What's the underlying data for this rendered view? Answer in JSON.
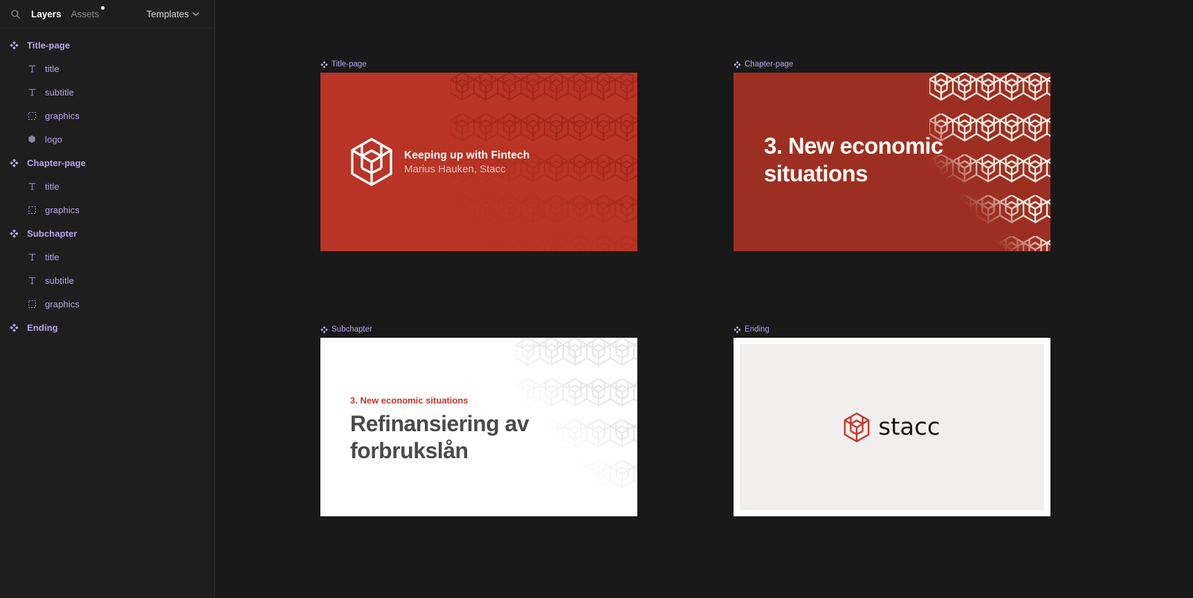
{
  "sidebar": {
    "search_icon": "search-icon",
    "tabs": [
      {
        "label": "Layers",
        "active": true,
        "badge": false
      },
      {
        "label": "Assets",
        "active": false,
        "badge": true
      }
    ],
    "templates_dropdown": {
      "label": "Templates",
      "chevron_icon": "chevron-down-icon"
    },
    "layers": [
      {
        "label": "Title-page",
        "icon": "component-icon",
        "level": 0
      },
      {
        "label": "title",
        "icon": "text-icon",
        "level": 1
      },
      {
        "label": "subtitle",
        "icon": "text-icon",
        "level": 1
      },
      {
        "label": "graphics",
        "icon": "frame-icon",
        "level": 1
      },
      {
        "label": "logo",
        "icon": "polygon-icon",
        "level": 1
      },
      {
        "label": "Chapter-page",
        "icon": "component-icon",
        "level": 0
      },
      {
        "label": "title",
        "icon": "text-icon",
        "level": 1
      },
      {
        "label": "graphics",
        "icon": "frame-icon",
        "level": 1
      },
      {
        "label": "Subchapter",
        "icon": "component-icon",
        "level": 0
      },
      {
        "label": "title",
        "icon": "text-icon",
        "level": 1
      },
      {
        "label": "subtitle",
        "icon": "text-icon",
        "level": 1
      },
      {
        "label": "graphics",
        "icon": "frame-icon",
        "level": 1
      },
      {
        "label": "Ending",
        "icon": "component-icon",
        "level": 0
      }
    ]
  },
  "canvas": {
    "frames": [
      {
        "name": "Title-page",
        "title": "Keeping up with Fintech",
        "subtitle": "Marius Hauken, Stacc",
        "background": "#b93426",
        "pattern_color": "#a22a1e"
      },
      {
        "name": "Chapter-page",
        "title": "3. New economic situations",
        "background": "#9d2f22",
        "pattern_color": "#f5ece2"
      },
      {
        "name": "Subchapter",
        "eyebrow": "3. New economic situations",
        "title": "Refinansiering av forbrukslån",
        "background": "#ffffff",
        "pattern_color": "#ebebeb",
        "eyebrow_color": "#c0392b",
        "title_color": "#4a4a4a"
      },
      {
        "name": "Ending",
        "wordmark": "stacc",
        "background": "#ffffff",
        "panel_color": "#f0efed",
        "logo_color": "#c0392b"
      }
    ]
  },
  "colors": {
    "component_purple": "#b9a5f0",
    "brand_red": "#b93426",
    "canvas_bg": "#191919",
    "panel_bg": "#1e1e1e"
  }
}
